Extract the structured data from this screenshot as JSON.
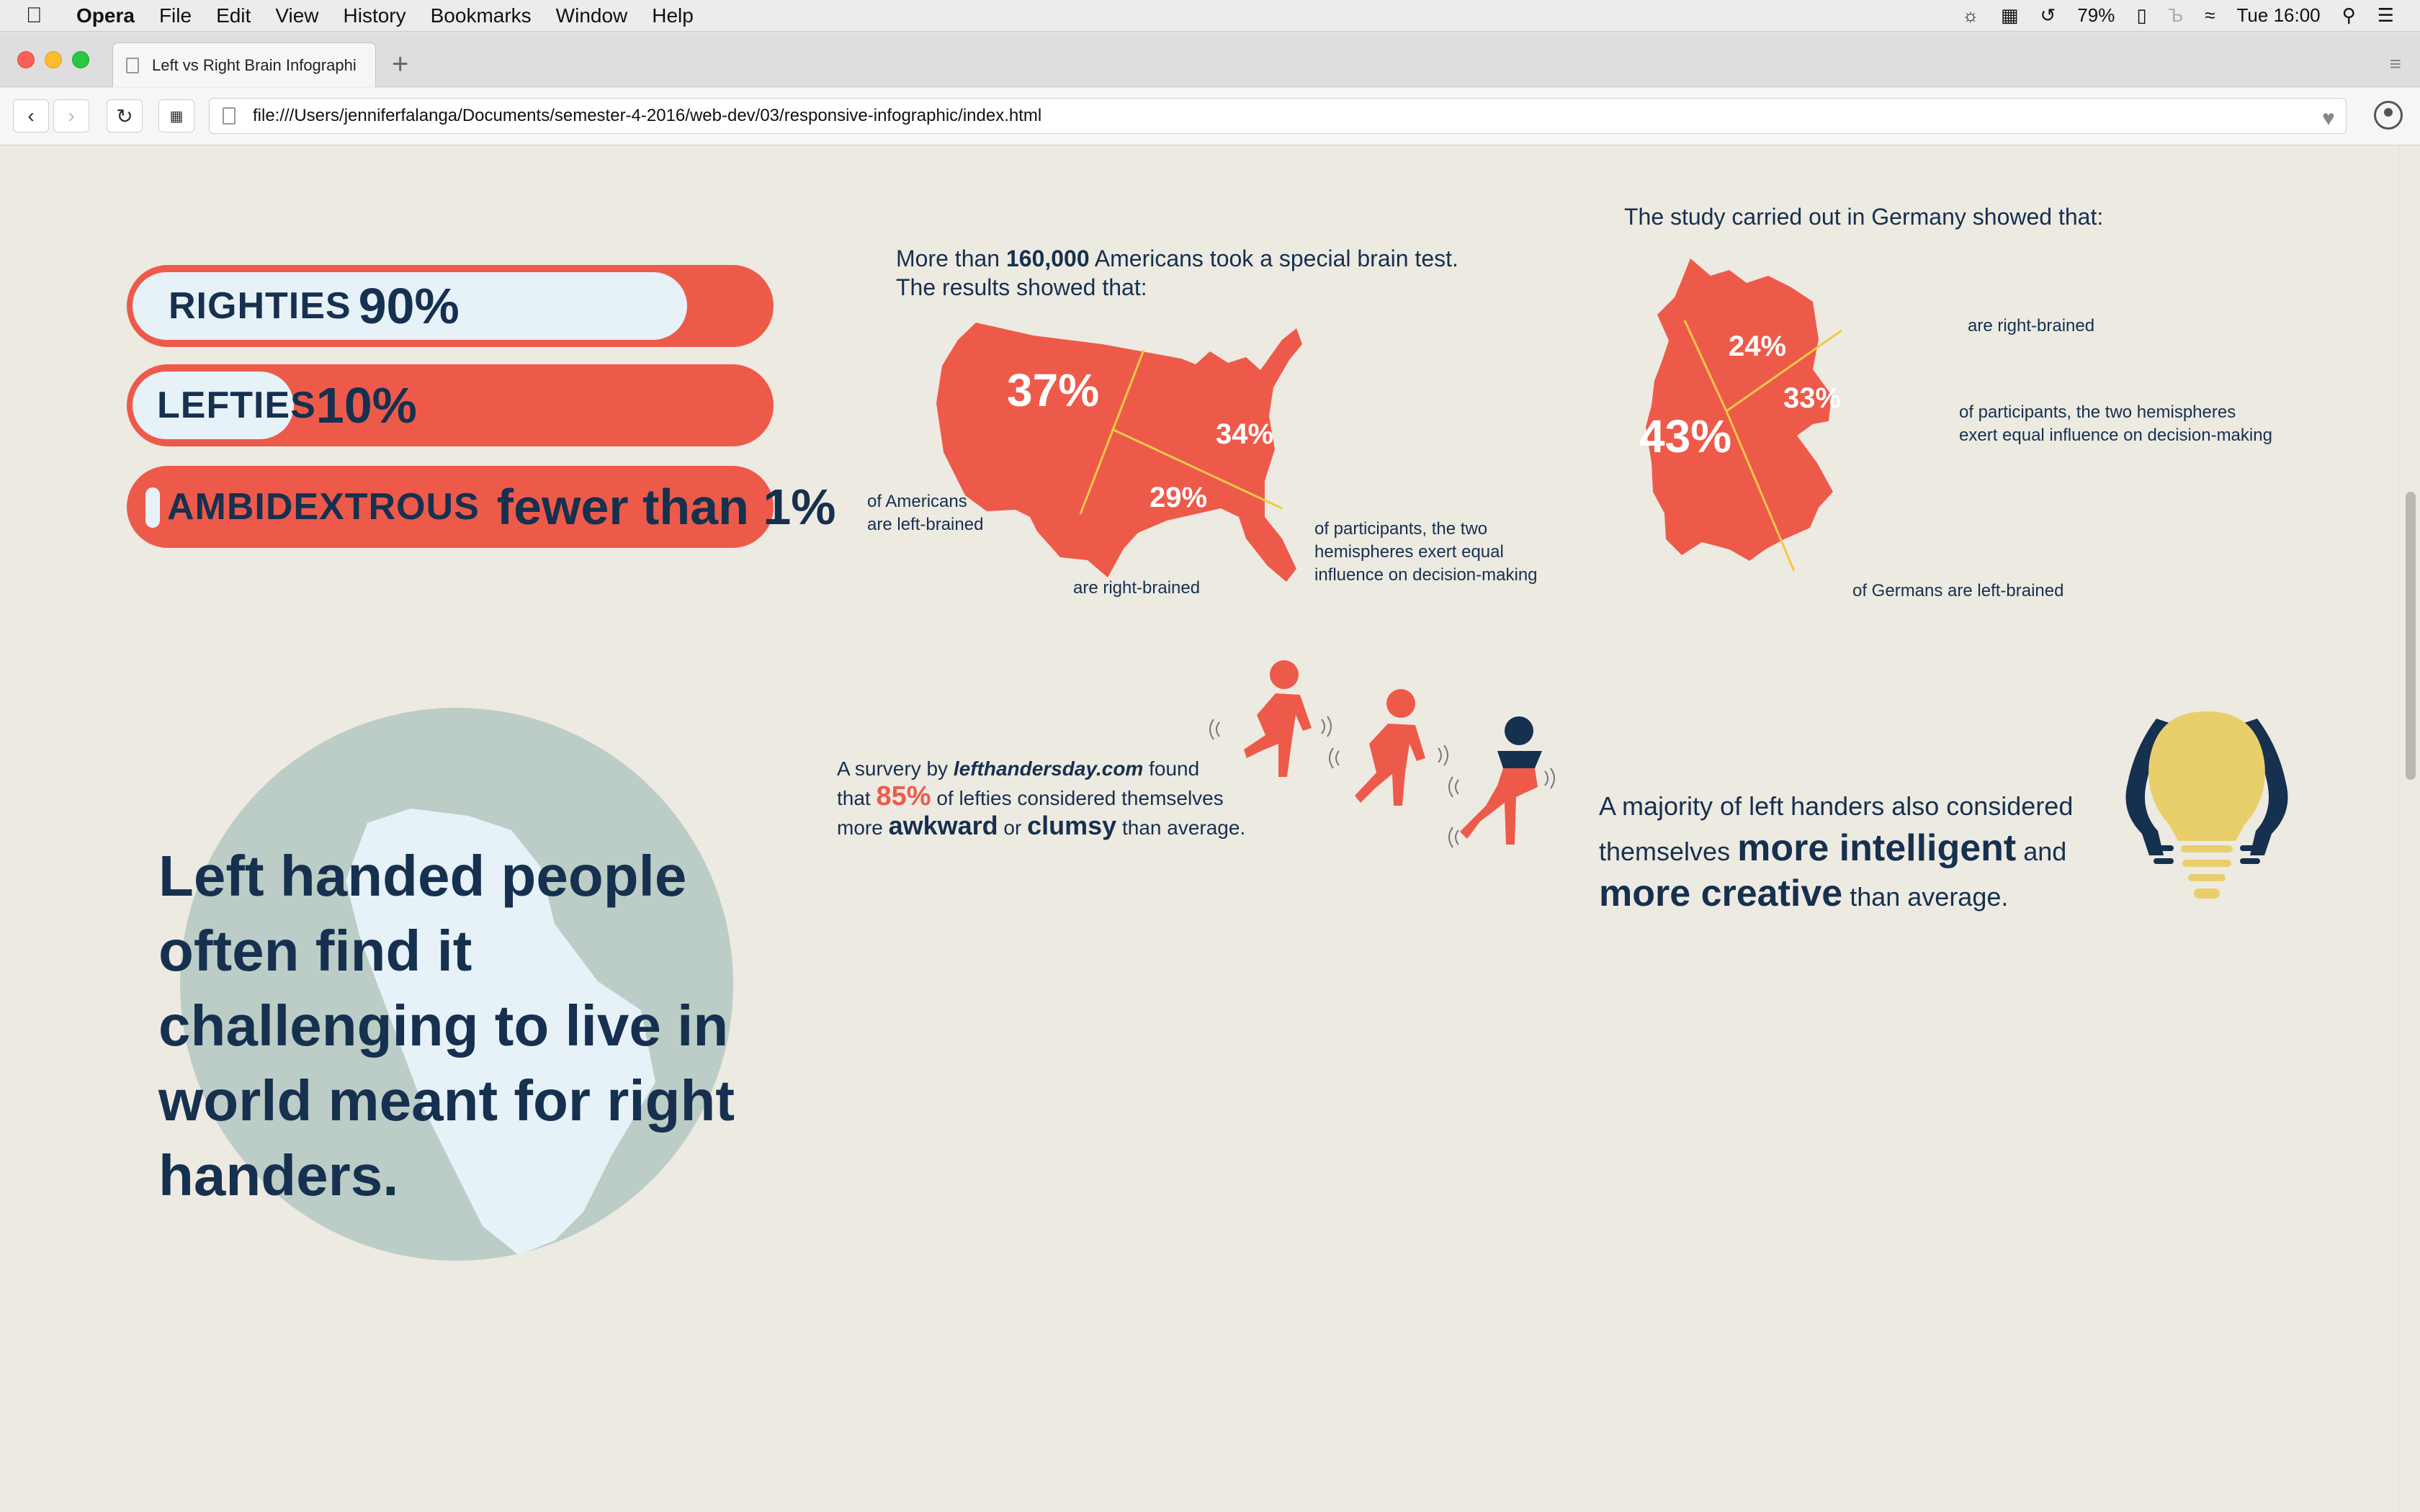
{
  "menubar": {
    "app": "Opera",
    "items": [
      "File",
      "Edit",
      "View",
      "History",
      "Bookmarks",
      "Window",
      "Help"
    ],
    "battery": "79%",
    "clock": "Tue 16:00"
  },
  "browser": {
    "tab_title": "Left vs Right Brain Infographi",
    "url": "file:///Users/jenniferfalanga/Documents/semester-4-2016/web-dev/03/responsive-infographic/index.html"
  },
  "bars": [
    {
      "word": "RIGHTIES",
      "value": "90%",
      "fill_fraction": 0.86
    },
    {
      "word": "LEFTIES",
      "value": "10%",
      "fill_fraction": 0.25
    },
    {
      "word": "AMBIDEXTROUS",
      "value": "fewer than 1%",
      "fill_fraction": 0.03
    }
  ],
  "usa": {
    "intro_pre": "More than ",
    "intro_num": "160,000",
    "intro_post": " Americans took a special brain test.",
    "intro_line2": "The results showed that:",
    "pct_left": "37%",
    "pct_equal": "34%",
    "pct_right": "29%",
    "label_left_1": "of Americans",
    "label_left_2": "are left-brained",
    "label_right": "are right-brained",
    "label_equal_1": "of participants, the two",
    "label_equal_2": "hemispheres exert equal",
    "label_equal_3": "influence on decision-making"
  },
  "germany": {
    "intro": "The study carried out in Germany showed that:",
    "pct_right": "24%",
    "pct_equal": "33%",
    "pct_left": "43%",
    "label_right": "are right-brained",
    "label_equal_1": "of participants, the two hemispheres",
    "label_equal_2": "exert equal influence on decision-making",
    "label_left": "of Germans are left-brained"
  },
  "quote": "Left handed people often find it challenging to live in world meant for right handers.",
  "survey": {
    "l1_pre": "A survery by ",
    "site": "lefthandersday.com",
    "l1_post": " found",
    "l2_pre": "that ",
    "pct": "85%",
    "l2_post": " of lefties considered themselves",
    "l3_pre": "more ",
    "awkward": "awkward",
    "or": " or ",
    "clumsy": "clumsy",
    "l3_post": " than average."
  },
  "majority": {
    "l1": "A majority of left handers also considered",
    "l2_pre": "themselves ",
    "intelligent": "more intelligent",
    "l2_post": " and",
    "creative": "more creative",
    "l3_post": " than average."
  },
  "colors": {
    "coral": "#ee5a4a",
    "navy": "#16304f",
    "globe": "#bccdc7",
    "bulb": "#e9cf6b",
    "background": "#edeae2"
  }
}
